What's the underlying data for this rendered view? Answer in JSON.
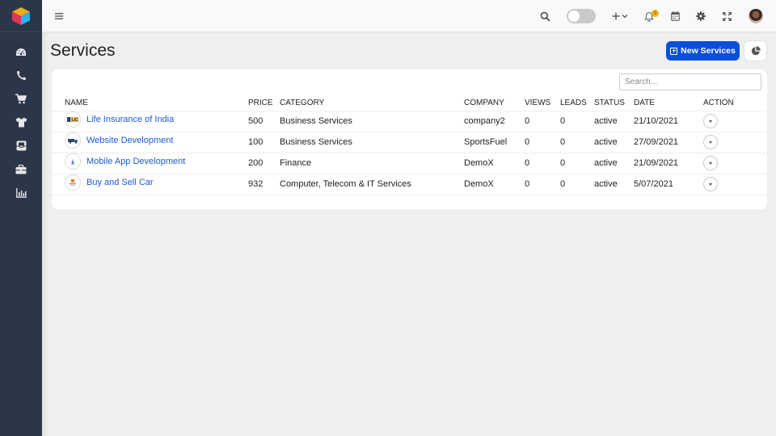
{
  "sidebar": {
    "logo": "cube-logo-icon",
    "items": [
      {
        "icon": "dashboard-icon",
        "label": "Dashboard"
      },
      {
        "icon": "phone-icon",
        "label": "Calls"
      },
      {
        "icon": "cart-icon",
        "label": "Cart"
      },
      {
        "icon": "tshirt-icon",
        "label": "Products"
      },
      {
        "icon": "inbox-icon",
        "label": "Inbox"
      },
      {
        "icon": "briefcase-icon",
        "label": "Services"
      },
      {
        "icon": "bar-chart-icon",
        "label": "Reports"
      }
    ]
  },
  "topbar": {
    "menu_icon": "hamburger-icon",
    "search_icon": "search-icon",
    "theme_toggle_on": false,
    "add_icon": "plus-icon",
    "notification_count": "0",
    "calendar_icon": "calendar-icon",
    "settings_icon": "gear-icon",
    "fullscreen_icon": "expand-icon",
    "avatar": "user-avatar"
  },
  "page": {
    "title": "Services",
    "new_button_label": "New Services",
    "chart_button_icon": "pie-chart-icon"
  },
  "search": {
    "placeholder": "Search...",
    "value": ""
  },
  "table": {
    "columns": [
      "NAME",
      "PRICE",
      "CATEGORY",
      "COMPANY",
      "VIEWS",
      "LEADS",
      "STATUS",
      "DATE",
      "ACTION"
    ],
    "rows": [
      {
        "logo": "lic-logo",
        "name": "Life Insurance of India",
        "price": "500",
        "category": "Business Services",
        "company": "company2",
        "views": "0",
        "leads": "0",
        "status": "active",
        "date": "21/10/2021"
      },
      {
        "logo": "truck-logo",
        "name": "Website Development",
        "price": "100",
        "category": "Business Services",
        "company": "SportsFuel",
        "views": "0",
        "leads": "0",
        "status": "active",
        "date": "27/09/2021"
      },
      {
        "logo": "app-logo",
        "name": "Mobile App Development",
        "price": "200",
        "category": "Finance",
        "company": "DemoX",
        "views": "0",
        "leads": "0",
        "status": "active",
        "date": "21/09/2021"
      },
      {
        "logo": "car-logo",
        "name": "Buy and Sell Car",
        "price": "932",
        "category": "Computer, Telecom & IT Services",
        "company": "DemoX",
        "views": "0",
        "leads": "0",
        "status": "active",
        "date": "5/07/2021"
      }
    ]
  },
  "colors": {
    "sidebar_bg": "#2c3649",
    "primary": "#0b4fd8",
    "link": "#1a5ad6",
    "badge": "#f2b705"
  }
}
